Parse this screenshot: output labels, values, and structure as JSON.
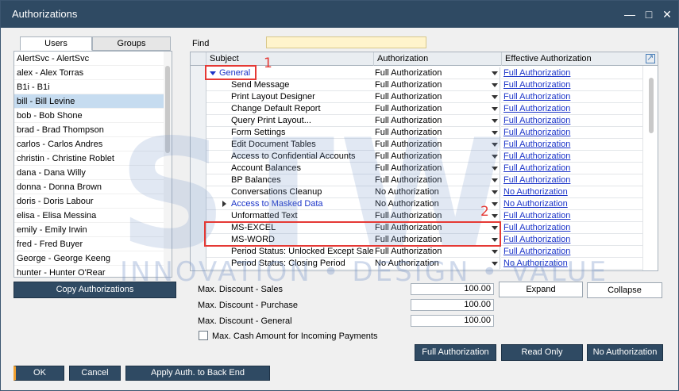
{
  "window": {
    "title": "Authorizations"
  },
  "tabs": {
    "users": "Users",
    "groups": "Groups"
  },
  "users": [
    "AlertSvc - AlertSvc",
    "alex - Alex Torras",
    "B1i - B1i",
    "bill - Bill Levine",
    "bob - Bob Shone",
    "brad - Brad Thompson",
    "carlos - Carlos Andres",
    "christin - Christine Roblet",
    "dana - Dana Willy",
    "donna - Donna Brown",
    "doris - Doris Labour",
    "elisa - Elisa Messina",
    "emily - Emily Irwin",
    "fred - Fred Buyer",
    "George - George Keeng",
    "hunter - Hunter O'Rear"
  ],
  "selected_user_index": 3,
  "buttons": {
    "copy_auth": "Copy Authorizations",
    "expand": "Expand",
    "collapse": "Collapse",
    "full_auth": "Full Authorization",
    "read_only": "Read Only",
    "no_auth": "No Authorization",
    "ok": "OK",
    "cancel": "Cancel",
    "apply_back_end": "Apply Auth. to Back End"
  },
  "find": {
    "label": "Find",
    "value": ""
  },
  "grid": {
    "headers": {
      "subject": "Subject",
      "authorization": "Authorization",
      "effective": "Effective Authorization"
    },
    "rows": [
      {
        "subject": "General",
        "auth": "Full Authorization",
        "effective": "Full Authorization"
      },
      {
        "subject": "Send Message",
        "auth": "Full Authorization",
        "effective": "Full Authorization"
      },
      {
        "subject": "Print Layout Designer",
        "auth": "Full Authorization",
        "effective": "Full Authorization"
      },
      {
        "subject": "Change Default Report",
        "auth": "Full Authorization",
        "effective": "Full Authorization"
      },
      {
        "subject": "Query Print Layout...",
        "auth": "Full Authorization",
        "effective": "Full Authorization"
      },
      {
        "subject": "Form Settings",
        "auth": "Full Authorization",
        "effective": "Full Authorization"
      },
      {
        "subject": "Edit Document Tables",
        "auth": "Full Authorization",
        "effective": "Full Authorization"
      },
      {
        "subject": "Access to Confidential Accounts",
        "auth": "Full Authorization",
        "effective": "Full Authorization"
      },
      {
        "subject": "Account Balances",
        "auth": "Full Authorization",
        "effective": "Full Authorization"
      },
      {
        "subject": "BP Balances",
        "auth": "Full Authorization",
        "effective": "Full Authorization"
      },
      {
        "subject": "Conversations Cleanup",
        "auth": "No Authorization",
        "effective": "No Authorization"
      },
      {
        "subject": "Access to Masked Data",
        "auth": "No Authorization",
        "effective": "No Authorization"
      },
      {
        "subject": "Unformatted Text",
        "auth": "Full Authorization",
        "effective": "Full Authorization"
      },
      {
        "subject": "MS-EXCEL",
        "auth": "Full Authorization",
        "effective": "Full Authorization"
      },
      {
        "subject": "MS-WORD",
        "auth": "Full Authorization",
        "effective": "Full Authorization"
      },
      {
        "subject": "Period Status: Unlocked Except Sales",
        "auth": "Full Authorization",
        "effective": "Full Authorization"
      },
      {
        "subject": "Period Status: Closing Period",
        "auth": "No Authorization",
        "effective": "No Authorization"
      }
    ]
  },
  "discounts": [
    {
      "label": "Max. Discount - Sales",
      "value": "100.00"
    },
    {
      "label": "Max. Discount - Purchase",
      "value": "100.00"
    },
    {
      "label": "Max. Discount - General",
      "value": "100.00"
    }
  ],
  "max_cash": {
    "label": "Max. Cash Amount for Incoming Payments",
    "checked": false
  },
  "annotations": {
    "one": "1",
    "two": "2"
  },
  "watermark": {
    "big": "STW",
    "small": "INNOVATION • DESIGN • VALUE"
  }
}
